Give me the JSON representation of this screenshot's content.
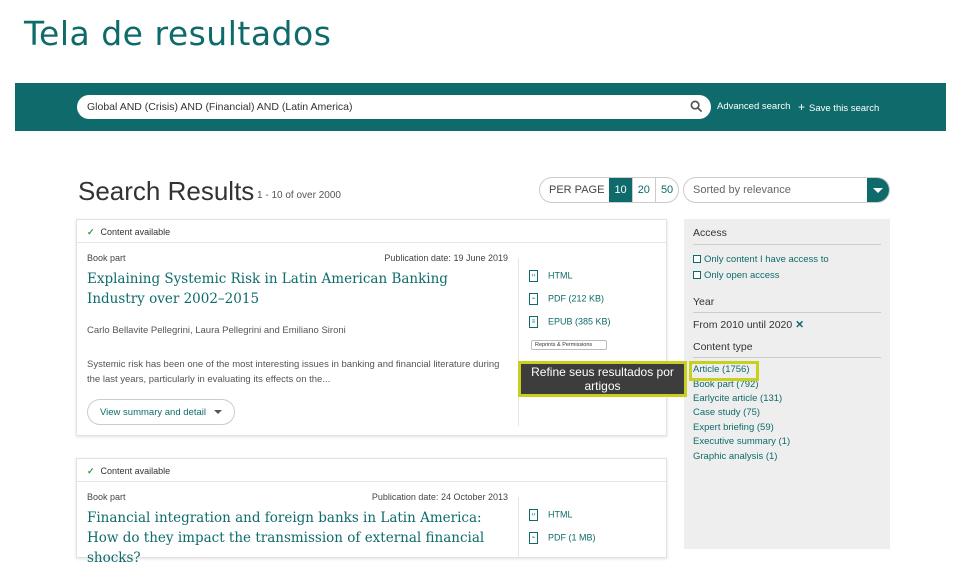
{
  "slide": {
    "title": "Tela de resultados"
  },
  "topbar": {
    "search_value": "Global AND (Crisis) AND (Financial) AND (Latin America)",
    "advanced_label": "Advanced search",
    "save_label": "Save this search",
    "bg_color": "#0f6b6b"
  },
  "results": {
    "title": "Search Results",
    "count": "1 - 10 of over 2000",
    "per_page_label": "PER PAGE",
    "per_page_options": [
      "10",
      "20",
      "50"
    ],
    "per_page_selected": "10",
    "sort_value": "Sorted by relevance"
  },
  "cards": [
    {
      "availability": "Content available",
      "type": "Book part",
      "date": "Publication date: 19 June 2019",
      "title": "Explaining Systemic Risk in Latin American Banking Industry over 2002–2015",
      "authors": "Carlo Bellavite Pellegrini, Laura Pellegrini and Emiliano Sironi",
      "abstract": "Systemic risk has been one of the most interesting issues in banking and financial literature during the last years, particularly in evaluating its effects on the...",
      "button": "View summary and detail",
      "formats": [
        "HTML",
        "PDF (212 KB)",
        "EPUB (385 KB)"
      ],
      "reprints": "Reprints & Permissions"
    },
    {
      "availability": "Content available",
      "type": "Book part",
      "date": "Publication date: 24 October 2013",
      "title": "Financial integration and foreign banks in Latin America: How do they impact the transmission of external financial shocks?",
      "formats": [
        "HTML",
        "PDF (1 MB)"
      ]
    }
  ],
  "sidebar": {
    "access_heading": "Access",
    "access_options": [
      "Only content I have access to",
      "Only open access"
    ],
    "year_heading": "Year",
    "year_value": "From 2010 until 2020",
    "content_type_heading": "Content type",
    "content_types": [
      "Article (1756)",
      "Book part (792)",
      "Earlycite article (131)",
      "Case study (75)",
      "Expert briefing (59)",
      "Executive summary (1)",
      "Graphic analysis (1)"
    ]
  },
  "callout": {
    "text": "Refine seus resultados por artigos",
    "border_color": "#c8cf1e"
  }
}
